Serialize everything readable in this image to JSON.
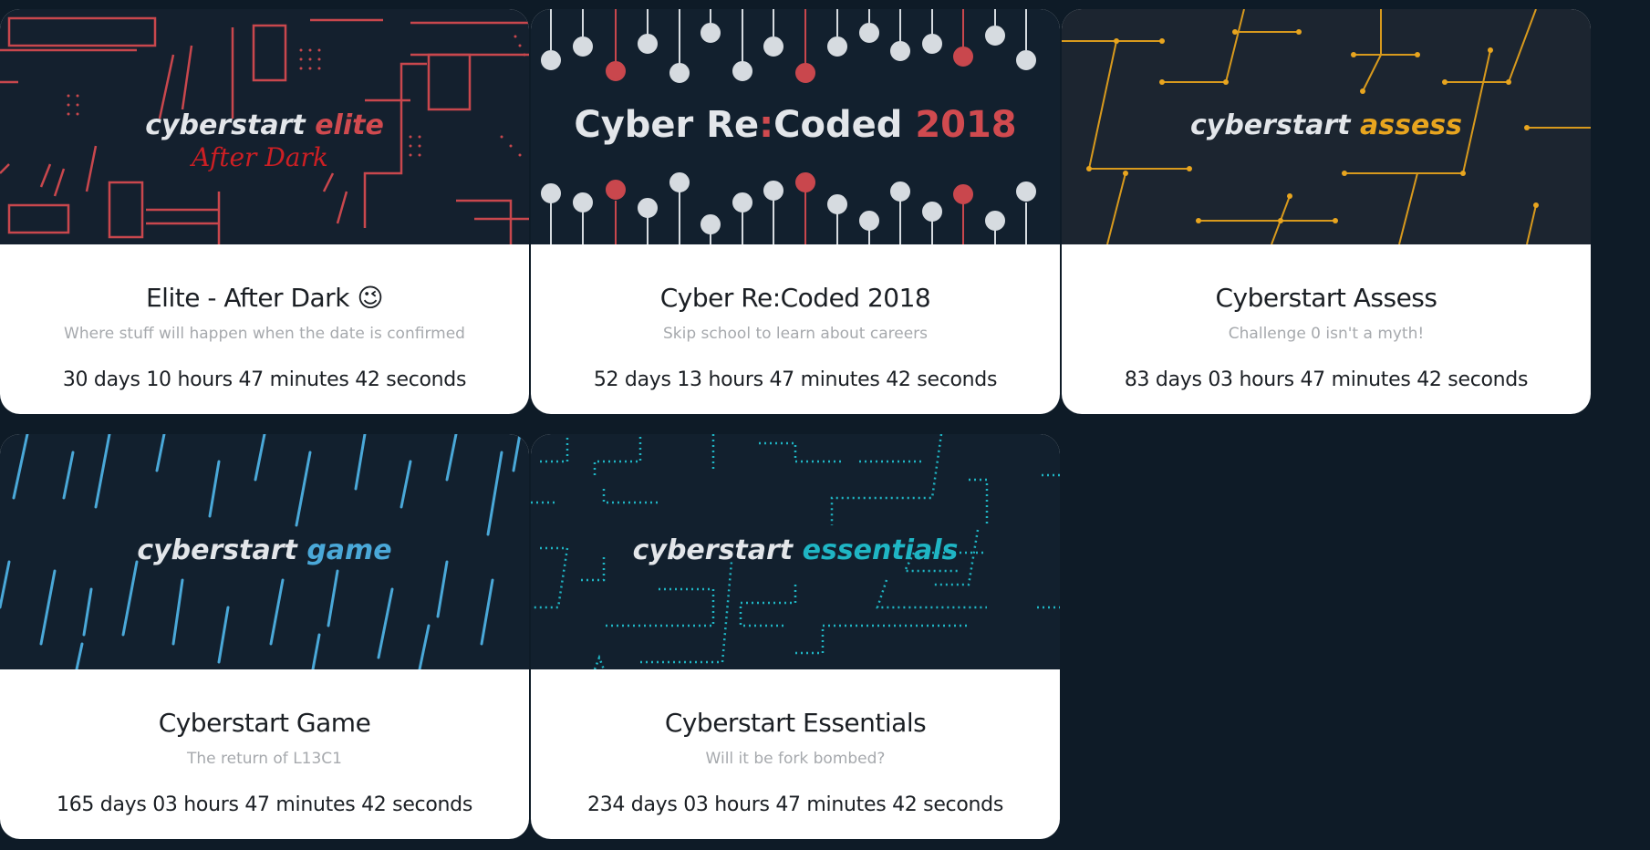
{
  "cards": [
    {
      "banner_main": "cyberstart",
      "banner_accent": "elite",
      "banner_script": "After Dark",
      "title": "Elite - After Dark 😉",
      "subtitle": "Where stuff will happen when the date is confirmed",
      "countdown": "30 days 10 hours 47 minutes 42 seconds",
      "accent_color": "#d04a4f"
    },
    {
      "banner_main": "Cyber Re",
      "banner_colon": ":",
      "banner_main2": "Coded",
      "banner_accent": "2018",
      "title": "Cyber Re:Coded 2018",
      "subtitle": "Skip school to learn about careers",
      "countdown": "52 days 13 hours 47 minutes 42 seconds",
      "accent_color": "#d04a4f"
    },
    {
      "banner_main": "cyberstart",
      "banner_accent": "assess",
      "title": "Cyberstart Assess",
      "subtitle": "Challenge 0 isn't a myth!",
      "countdown": "83 days 03 hours 47 minutes 42 seconds",
      "accent_color": "#e8a51f"
    },
    {
      "banner_main": "cyberstart",
      "banner_accent": "game",
      "title": "Cyberstart Game",
      "subtitle": "The return of L13C1",
      "countdown": "165 days 03 hours 47 minutes 42 seconds",
      "accent_color": "#4aa8d8"
    },
    {
      "banner_main": "cyberstart",
      "banner_accent": "essentials",
      "title": "Cyberstart Essentials",
      "subtitle": "Will it be fork bombed?",
      "countdown": "234 days 03 hours 47 minutes 42 seconds",
      "accent_color": "#1fb5c4"
    }
  ],
  "colors": {
    "page_bg": "#0e1b27",
    "banner_bg": "#12202e",
    "banner_text": "#e8ecef",
    "bulb": "#d8dde2"
  }
}
